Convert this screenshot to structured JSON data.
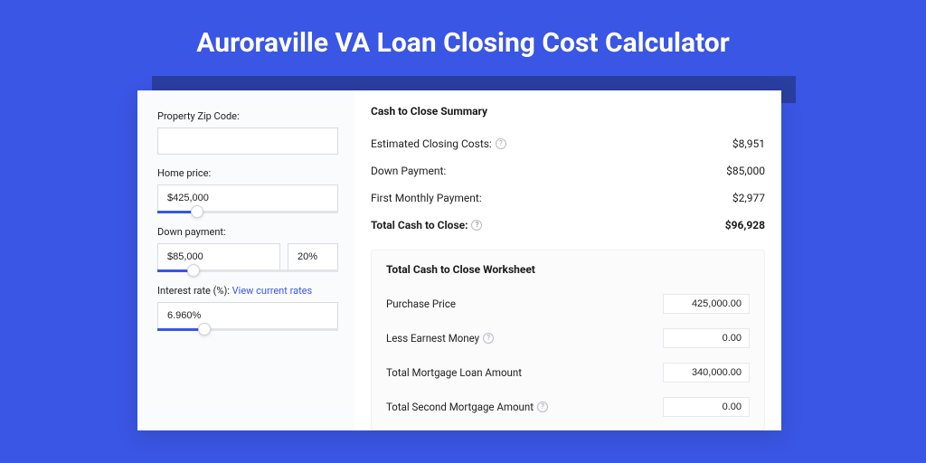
{
  "header": {
    "title": "Auroraville VA Loan Closing Cost Calculator"
  },
  "left": {
    "zip_label": "Property Zip Code:",
    "zip_value": "",
    "home_price_label": "Home price:",
    "home_price_value": "$425,000",
    "home_price_slider_pct": 22,
    "down_payment_label": "Down payment:",
    "down_payment_value": "$85,000",
    "down_payment_pct": "20%",
    "down_payment_slider_pct": 20,
    "rate_label": "Interest rate (%):",
    "rate_link": "View current rates",
    "rate_value": "6.960%",
    "rate_slider_pct": 26
  },
  "summary": {
    "title": "Cash to Close Summary",
    "rows": [
      {
        "label": "Estimated Closing Costs:",
        "help": true,
        "value": "$8,951"
      },
      {
        "label": "Down Payment:",
        "help": false,
        "value": "$85,000"
      },
      {
        "label": "First Monthly Payment:",
        "help": false,
        "value": "$2,977"
      }
    ],
    "total_label": "Total Cash to Close:",
    "total_value": "$96,928"
  },
  "worksheet": {
    "title": "Total Cash to Close Worksheet",
    "rows": [
      {
        "label": "Purchase Price",
        "help": false,
        "value": "425,000.00"
      },
      {
        "label": "Less Earnest Money",
        "help": true,
        "value": "0.00"
      },
      {
        "label": "Total Mortgage Loan Amount",
        "help": false,
        "value": "340,000.00"
      },
      {
        "label": "Total Second Mortgage Amount",
        "help": true,
        "value": "0.00"
      }
    ]
  }
}
